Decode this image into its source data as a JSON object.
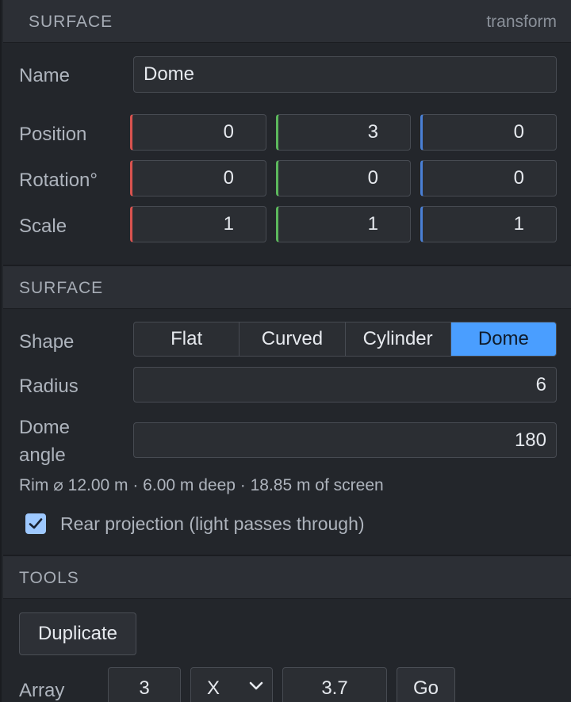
{
  "header": {
    "title": "SURFACE",
    "subtitle": "transform"
  },
  "name_row": {
    "label": "Name",
    "value": "Dome"
  },
  "transform": {
    "position": {
      "label": "Position",
      "x": "0",
      "y": "3",
      "z": "0"
    },
    "rotation": {
      "label": "Rotation°",
      "x": "0",
      "y": "0",
      "z": "0"
    },
    "scale": {
      "label": "Scale",
      "x": "1",
      "y": "1",
      "z": "1"
    }
  },
  "surface_section": {
    "title": "SURFACE",
    "shape_label": "Shape",
    "shapes": [
      "Flat",
      "Curved",
      "Cylinder",
      "Dome"
    ],
    "selected_shape": "Dome",
    "radius_label": "Radius",
    "radius_value": "6",
    "dome_angle_label_1": "Dome",
    "dome_angle_label_2": "angle",
    "dome_angle_value": "180",
    "info": "Rim ⌀ 12.00 m · 6.00 m deep · 18.85 m of screen",
    "rear_projection_label": "Rear projection (light passes through)",
    "rear_projection_checked": true
  },
  "tools_section": {
    "title": "TOOLS",
    "duplicate_label": "Duplicate",
    "array_label": "Array",
    "array_count": "3",
    "array_axis": "X",
    "array_spacing": "3.7",
    "go_label": "Go"
  },
  "colors": {
    "accent": "#4a9eff",
    "axis_x": "#d9534f",
    "axis_y": "#5cb85c",
    "axis_z": "#4a80d6"
  }
}
